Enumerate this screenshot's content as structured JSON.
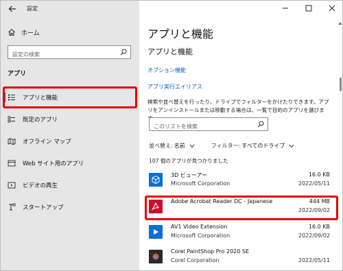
{
  "window": {
    "title": "設定"
  },
  "sidebar": {
    "home_label": "ホーム",
    "search_placeholder": "設定の検索",
    "section_heading": "アプリ",
    "items": [
      {
        "label": "アプリと機能",
        "icon": "apps-features-icon",
        "active": true
      },
      {
        "label": "既定のアプリ",
        "icon": "default-apps-icon",
        "active": false
      },
      {
        "label": "オフライン マップ",
        "icon": "offline-maps-icon",
        "active": false
      },
      {
        "label": "Web サイト用のアプリ",
        "icon": "apps-for-websites-icon",
        "active": false
      },
      {
        "label": "ビデオの再生",
        "icon": "video-playback-icon",
        "active": false
      },
      {
        "label": "スタートアップ",
        "icon": "startup-icon",
        "active": false
      }
    ]
  },
  "main": {
    "page_title": "アプリと機能",
    "sub_title": "アプリと機能",
    "link_optional_features": "オプション機能",
    "link_app_aliases": "アプリ実行エイリアス",
    "description": "検索や並べ替えを行ったり、ドライブでフィルターをかけたりできます。アプリをアンインストールまたは移動する場合は、一覧で目的のアプリを選びます。",
    "list_search_placeholder": "このリストを検索",
    "sort_label": "並べ替え:",
    "sort_value": "名前",
    "filter_label": "フィルター:",
    "filter_value": "すべてのドライブ",
    "app_count": "107 個のアプリが見つかりました",
    "apps": [
      {
        "name": "3D ビューアー",
        "publisher": "Microsoft Corporation",
        "size": "16.0 KB",
        "date": "2022/05/11",
        "icon": "3d-viewer-icon",
        "color": "#0a6fd6"
      },
      {
        "name": "Adobe Acrobat Reader DC - Japanese",
        "publisher": "",
        "size": "444 MB",
        "date": "2022/09/02",
        "icon": "acrobat-reader-icon",
        "color": "#c8102e"
      },
      {
        "name": "AV1 Video Extension",
        "publisher": "Microsoft Corporation",
        "size": "16.0 KB",
        "date": "2022/09/02",
        "icon": "av1-extension-icon",
        "color": "#0a6fd6"
      },
      {
        "name": "Corel PaintShop Pro 2020 SE",
        "publisher": "Corel Corporation",
        "size": "",
        "date": "2022/05/11",
        "icon": "paintshop-pro-icon",
        "color": "#2a2a2a"
      }
    ]
  },
  "colors": {
    "accent": "#0a64c8",
    "highlight": "#e60000",
    "sidebar_bg": "#e6e6e6"
  }
}
